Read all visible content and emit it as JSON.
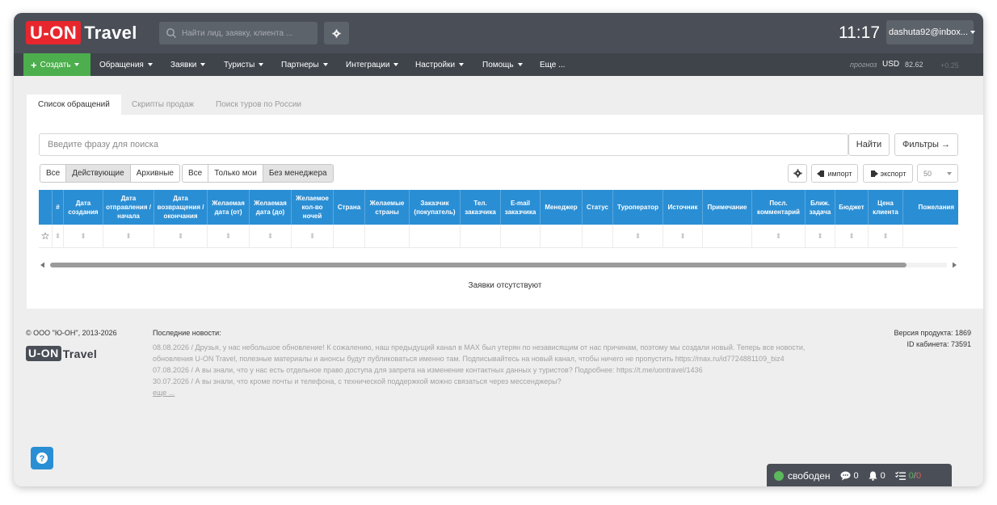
{
  "header": {
    "logo_left": "U-ON",
    "logo_right": "Travel",
    "search_placeholder": "Найти лид, заявку, клиента ...",
    "time": "11:17",
    "user": "dashuta92@inbox..."
  },
  "nav": {
    "create": "Создать",
    "items": [
      "Обращения",
      "Заявки",
      "Туристы",
      "Партнеры",
      "Интеграции",
      "Настройки",
      "Помощь",
      "Еще ..."
    ],
    "forecast": "прогноз",
    "currency": "USD",
    "rate": "82.62",
    "delta": "+0.25"
  },
  "tabs": [
    "Список обращений",
    "Скрипты продаж",
    "Поиск туров по России"
  ],
  "search": {
    "placeholder": "Введите фразу для поиска",
    "find": "Найти",
    "filters": "Фильтры →"
  },
  "filter_group_1": [
    "Все",
    "Действующие",
    "Архивные"
  ],
  "filter_group_2": [
    "Все",
    "Только мои",
    "Без менеджера"
  ],
  "toolbar": {
    "import": "импорт",
    "export": "экспорт",
    "page_size": "50"
  },
  "table": {
    "columns": [
      "#",
      "Дата создания",
      "Дата отправления / начала",
      "Дата возвращения / окончания",
      "Желаемая дата (от)",
      "Желаемая дата (до)",
      "Желаемое кол-во ночей",
      "Страна",
      "Желаемые страны",
      "Заказчик (покупатель)",
      "Тел. заказчика",
      "E-mail заказчика",
      "Менеджер",
      "Статус",
      "Туроператор",
      "Источник",
      "Примечание",
      "Посл. комментарий",
      "Ближ. задача",
      "Бюджет",
      "Цена клиента",
      "Пожелания"
    ],
    "empty_message": "Заявки отсутствуют"
  },
  "footer": {
    "copyright": "© ООО \"Ю-ОН\", 2013-2026",
    "news_title": "Последние новости:",
    "news": [
      "08.08.2026 / Друзья, у нас небольшое обновление! К сожалению, наш предыдущий канал в MAX был утерян по независящим от нас причинам, поэтому мы создали новый. Теперь все новости,",
      "обновления U-ON Travel, полезные материалы и анонсы будут публиковаться именно там. Подписывайтесь на новый канал, чтобы ничего не пропустить https://max.ru/id7724881109_biz4",
      "07.08.2026 / А вы знали, что у нас есть отдельное право доступа для запрета на изменение контактных данных у туристов? Подробнее: https://t.me/uontravel/1436",
      "30.07.2026 / А вы знали, что кроме почты и телефона, с технической поддержкой можно связаться через мессенджеры?"
    ],
    "more": "еще ...",
    "version": "Версия продукта: 1869",
    "cabinet": "ID кабинета: 73591"
  },
  "statusbar": {
    "state": "свободен",
    "messages": "0",
    "notifications": "0",
    "tasks_done": "0",
    "tasks_overdue": "0"
  }
}
